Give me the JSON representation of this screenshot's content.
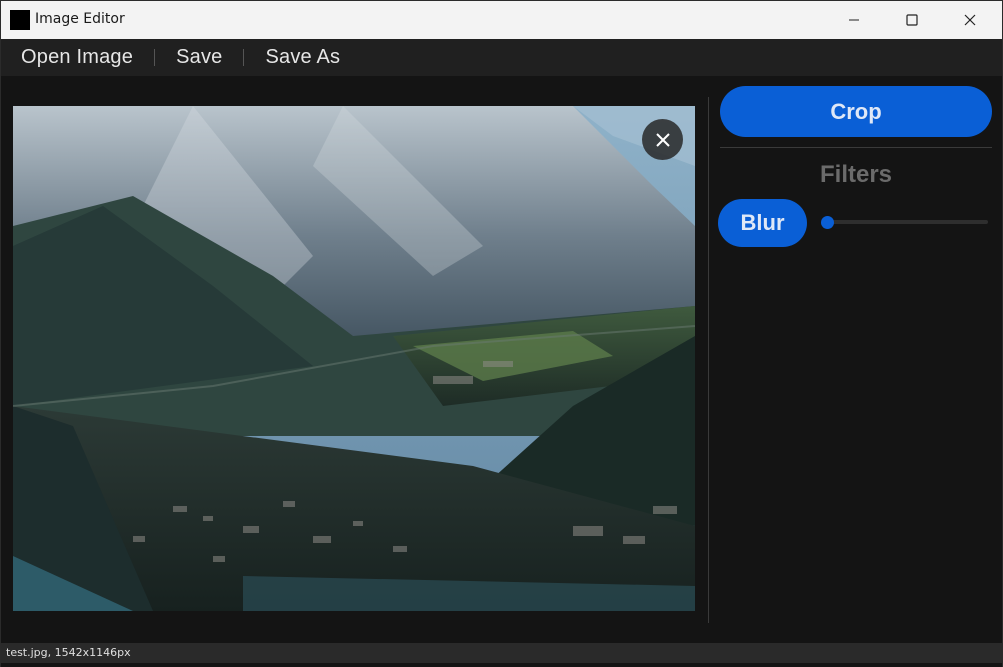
{
  "window": {
    "title": "Image Editor",
    "controls": [
      "minimize",
      "maximize",
      "close"
    ]
  },
  "menu": {
    "items": [
      {
        "label": "Open Image"
      },
      {
        "label": "Save"
      },
      {
        "label": "Save As"
      }
    ]
  },
  "canvas": {
    "close_icon": "close-icon",
    "image_description": "mountain valley town"
  },
  "panel": {
    "crop_label": "Crop",
    "filters_heading": "Filters",
    "blur_label": "Blur",
    "blur_value": 0
  },
  "status": {
    "text": "test.jpg, 1542x1146px"
  },
  "colors": {
    "accent": "#0a5fd6",
    "background": "#141414",
    "menubar": "#202020",
    "titlebar": "#f3f3f3"
  }
}
